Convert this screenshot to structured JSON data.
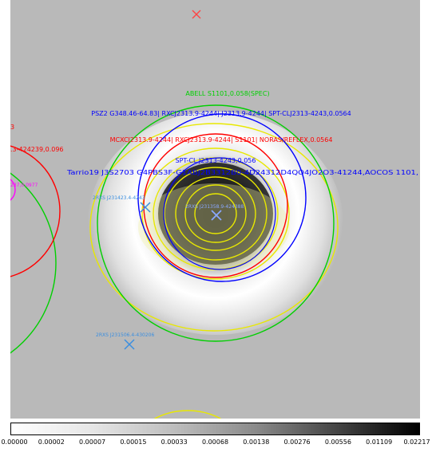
{
  "annotations": {
    "abell": "ABELL S1101,0.058(SPEC)",
    "psz2": "PSZ2 G348.46-64.83| RXCJ2313.9-4244| J2313.9-4244| SPT-CLJ2313-4243,0.0564",
    "mcxc": "MCXCJ2313.9-4244| RXCJ2313.9-4244| S1101| NORAS/REFLEX,0.0564",
    "left_red_fragment": ".3-424239,0.096",
    "left_red_small": "3",
    "spt": "SPT-CL J2313-4243,0.056",
    "tarrio": "Tarrio19 J3S2703 G4PBS3F-G1ABJ2B3312B0-4D24312D4QO4JO2O3-41244,AOCOS 1101,",
    "magenta_small": "237,0.0977",
    "rxs_left": "2RXS J231423.4-4243",
    "rxs_center": "2RXS J231358.9-424388",
    "rxs_bottom": "2RXS J231506.4-430206"
  },
  "colorbar": {
    "ticks": [
      "0.00000",
      "0.00002",
      "0.00007",
      "0.00015",
      "0.00033",
      "0.00068",
      "0.00138",
      "0.00276",
      "0.00556",
      "0.01109",
      "0.02217"
    ]
  },
  "colors": {
    "green": "#00d000",
    "blue": "#0000ff",
    "red": "#ff0000",
    "yellow": "#e8e800",
    "magenta": "#ff00ff",
    "label_blue": "#3a8ee0"
  }
}
